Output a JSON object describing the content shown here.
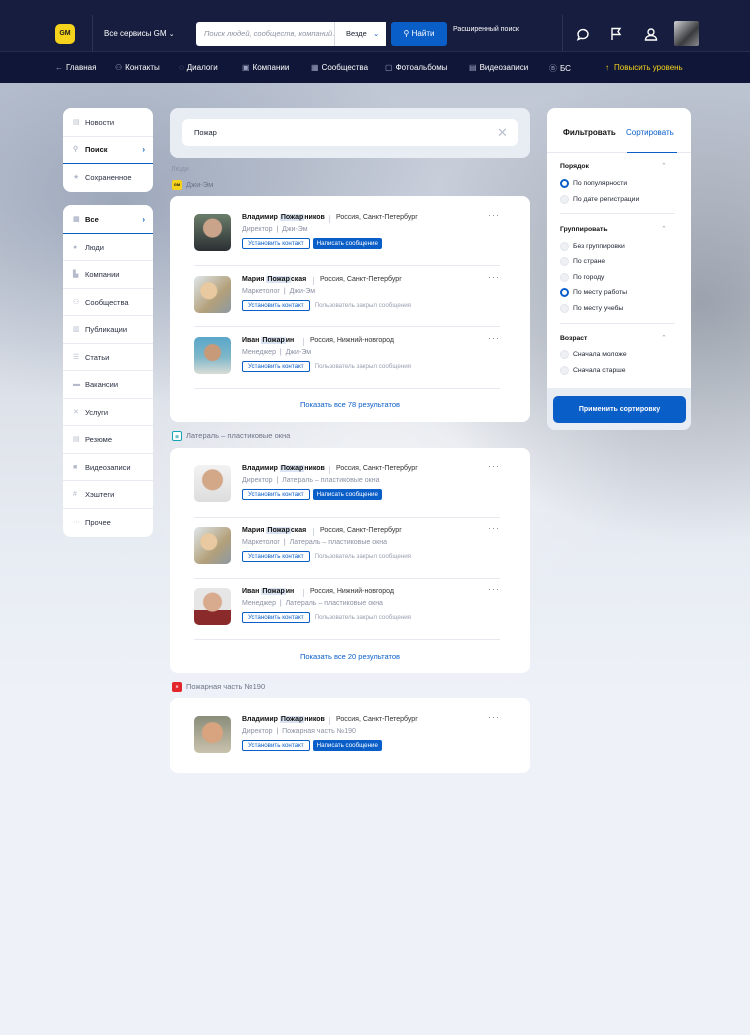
{
  "header": {
    "logo": "GM",
    "services": "Все сервисы GM",
    "search_placeholder": "Поиск людей, сообществ, компаний…",
    "scope": "Везде",
    "find_button": "Найти",
    "advanced_search": "Расширенный поиск"
  },
  "nav": {
    "items": [
      "Главная",
      "Контакты",
      "Диалоги",
      "Компании",
      "Сообщества",
      "Фотоальбомы",
      "Видеозаписи",
      "БС"
    ],
    "upgrade": "Повысить уровень"
  },
  "sidebar_top": [
    "Новости",
    "Поиск",
    "Сохраненное"
  ],
  "sidebar_categories": [
    "Все",
    "Люди",
    "Компании",
    "Сообщества",
    "Публикации",
    "Статьи",
    "Вакансии",
    "Услуги",
    "Резюме",
    "Видеозаписи",
    "Хэштеги",
    "Прочее"
  ],
  "query": "Пожар",
  "section_label": "Люди",
  "groups": [
    {
      "title": "Джи-Эм",
      "show_all": "Показать все 78 результатов",
      "people": [
        {
          "pre": "Владимир ",
          "hl": "Пожар",
          "post": "ников",
          "location": "Россия, Санкт-Петербург",
          "role": "Директор",
          "company": "Джи-Эм",
          "contact": "Установить контакт",
          "message": "Написать сообщение",
          "closed": ""
        },
        {
          "pre": "Мария ",
          "hl": "Пожар",
          "post": "ская",
          "location": "Россия, Санкт-Петербург",
          "role": "Маркетолог",
          "company": "Джи-Эм",
          "contact": "Установить контакт",
          "message": "",
          "closed": "Пользователь закрыл сообщения"
        },
        {
          "pre": "Иван ",
          "hl": "Пожар",
          "post": "ин",
          "location": "Россия, Нижний-новгород",
          "role": "Менеджер",
          "company": "Джи-Эм",
          "contact": "Установить контакт",
          "message": "",
          "closed": "Пользователь закрыл сообщения"
        }
      ]
    },
    {
      "title": "Латераль – пластиковые окна",
      "show_all": "Показать все 20 результатов",
      "people": [
        {
          "pre": "Владимир ",
          "hl": "Пожар",
          "post": "ников",
          "location": "Россия, Санкт-Петербург",
          "role": "Директор",
          "company": "Латераль – пластиковые окна",
          "contact": "Установить контакт",
          "message": "Написать сообщение",
          "closed": ""
        },
        {
          "pre": "Мария ",
          "hl": "Пожар",
          "post": "ская",
          "location": "Россия, Санкт-Петербург",
          "role": "Маркетолог",
          "company": "Латераль – пластиковые окна",
          "contact": "Установить контакт",
          "message": "",
          "closed": "Пользователь закрыл сообщения"
        },
        {
          "pre": "Иван ",
          "hl": "Пожар",
          "post": "ин",
          "location": "Россия, Нижний-новгород",
          "role": "Менеджер",
          "company": "Латераль – пластиковые окна",
          "contact": "Установить контакт",
          "message": "",
          "closed": "Пользователь закрыл сообщения"
        }
      ]
    },
    {
      "title": "Пожарная часть №190",
      "show_all": "",
      "people": [
        {
          "pre": "Владимир ",
          "hl": "Пожар",
          "post": "ников",
          "location": "Россия, Санкт-Петербург",
          "role": "Директор",
          "company": "Пожарная часть №190",
          "contact": "Установить контакт",
          "message": "Написать сообщение",
          "closed": ""
        }
      ]
    }
  ],
  "filters": {
    "tab_filter": "Фильтровать",
    "tab_sort": "Сортировать",
    "order_title": "Порядок",
    "order": [
      "По популярности",
      "По дате регистрации"
    ],
    "group_title": "Группировать",
    "group": [
      "Без группировки",
      "По стране",
      "По городу",
      "По месту работы",
      "По месту учебы"
    ],
    "age_title": "Возраст",
    "age": [
      "Сначала моложе",
      "Сначала старше"
    ],
    "apply": "Применить сортировку"
  },
  "colors": {
    "accent": "#0a5ec8",
    "header": "#161d3f",
    "logo": "#f5d21c"
  }
}
